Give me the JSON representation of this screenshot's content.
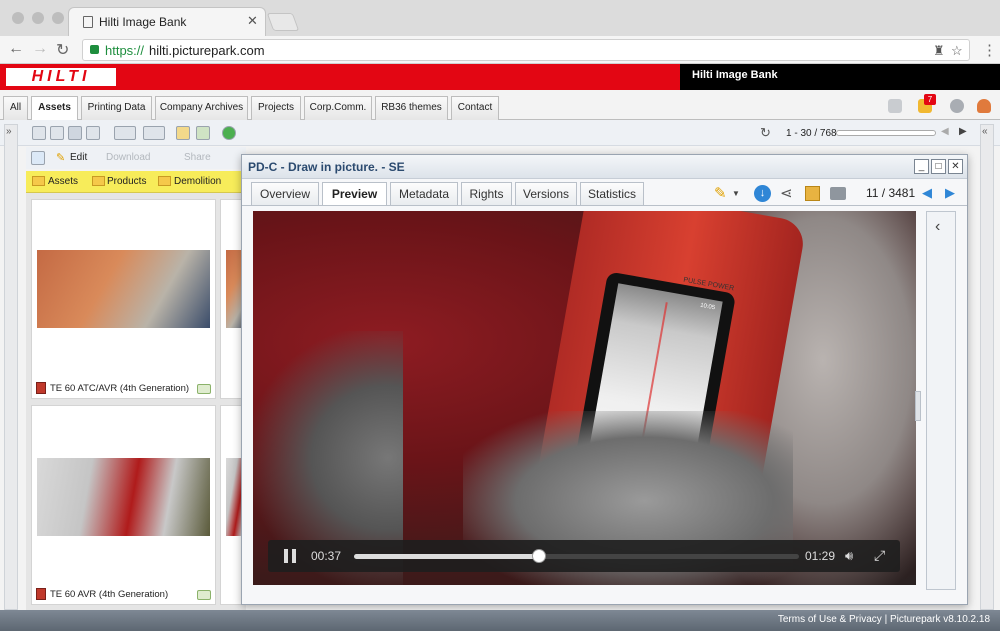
{
  "browser": {
    "tab_title": "Hilti Image Bank",
    "url_scheme": "https://",
    "url_host": "hilti.picturepark.com"
  },
  "header": {
    "logo_text": "HILTI",
    "site_title": "Hilti Image Bank",
    "brand_color": "#e30613"
  },
  "main_tabs": [
    {
      "label": "All"
    },
    {
      "label": "Assets"
    },
    {
      "label": "Printing Data"
    },
    {
      "label": "Company Archives"
    },
    {
      "label": "Projects"
    },
    {
      "label": "Corp.Comm."
    },
    {
      "label": "RB36 themes"
    },
    {
      "label": "Contact"
    }
  ],
  "notifications": {
    "badge": "7"
  },
  "pagination": {
    "range": "1 - 30 / 768"
  },
  "actions": {
    "edit": "Edit",
    "download": "Download",
    "share": "Share"
  },
  "categories": [
    {
      "label": "Assets"
    },
    {
      "label": "Products"
    },
    {
      "label": "Demolition"
    }
  ],
  "assets": [
    {
      "caption": "TE 60 ATC/AVR (4th Generation)"
    },
    {
      "caption": "TE 60 AVR (4th Generation)"
    }
  ],
  "modal": {
    "title": "PD-C - Draw in picture. - SE",
    "tabs": [
      {
        "label": "Overview"
      },
      {
        "label": "Preview"
      },
      {
        "label": "Metadata"
      },
      {
        "label": "Rights"
      },
      {
        "label": "Versions"
      },
      {
        "label": "Statistics"
      }
    ],
    "pager": "11 / 3481",
    "video": {
      "current_time": "00:37",
      "total_time": "01:29",
      "progress": 0.415,
      "device_brand": "PULSE POWER",
      "device_reading": "10:05"
    }
  },
  "footer": {
    "text": "Terms of Use & Privacy | Picturepark v8.10.2.18"
  }
}
